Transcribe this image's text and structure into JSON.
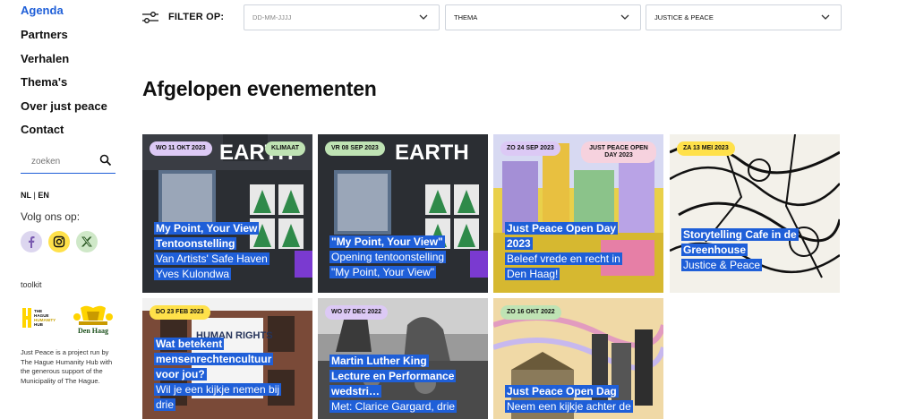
{
  "sidebar": {
    "nav": [
      "Agenda",
      "Partners",
      "Verhalen",
      "Thema's",
      "Over just peace",
      "Contact"
    ],
    "search_placeholder": "zoeken",
    "lang_nl": "NL",
    "lang_sep": " | ",
    "lang_en": "EN",
    "volg": "Volg ons op:",
    "toolkit": "toolkit",
    "logo_hub_lines": [
      "THE",
      "HAGUE",
      "HUMANITY",
      "HUB"
    ],
    "logo_city": "Den Haag",
    "footnote": "Just Peace is a project run by The Hague Humanity Hub with the generous support of the Municipality of The Hague."
  },
  "filter": {
    "label": "FILTER OP:",
    "date_placeholder": "DD-MM-JJJJ",
    "thema": "THEMA",
    "selected": "JUSTICE & PEACE"
  },
  "page_title": "Afgelopen evenementen",
  "colors": {
    "accent": "#1f5fd8",
    "badge_purple": "#dcc9f5",
    "badge_green": "#bfe3b4",
    "badge_yellow": "#ffe14a",
    "badge_pink": "#f6d2de"
  },
  "cards": [
    {
      "date": "WO 11 OKT 2023",
      "theme": "KLIMAAT",
      "title": [
        "My Point, Your View",
        "Tentoonstelling"
      ],
      "sub": [
        "Van Artists' Safe Haven",
        "Yves Kulondwa"
      ]
    },
    {
      "date": "VR 08 SEP 2023",
      "theme": "",
      "title": [
        "\"My Point, Your View\""
      ],
      "sub": [
        "Opening tentoonstelling",
        "\"My Point, Your View\""
      ]
    },
    {
      "date": "ZO 24 SEP 2023",
      "theme": "JUST PEACE OPEN DAY 2023",
      "title": [
        "Just Peace Open Day",
        "2023"
      ],
      "sub": [
        "Beleef vrede en recht in",
        "Den Haag!"
      ]
    },
    {
      "date": "ZA 13 MEI 2023",
      "theme": "",
      "title": [
        "Storytelling Cafe in de",
        "Greenhouse"
      ],
      "sub": [
        "Justice & Peace"
      ]
    },
    {
      "date": "DO 23 FEB 2023",
      "theme": "",
      "title": [
        "Wat betekent",
        "mensenrechtencultuur",
        "voor jou?"
      ],
      "sub": [
        "Wil je een kijkje nemen bij",
        "drie"
      ]
    },
    {
      "date": "WO 07 DEC 2022",
      "theme": "",
      "title": [
        "Martin Luther King",
        "Lecture en Performance",
        "wedstri…"
      ],
      "sub": [
        "Met: Clarice Gargard, drie"
      ]
    },
    {
      "date": "ZO 16 OKT 2022",
      "theme": "",
      "title": [
        "Just Peace Open Dag"
      ],
      "sub": [
        "Neem een kijkje achter de"
      ]
    }
  ],
  "card_art": [
    "EARTH",
    "EARTH",
    "",
    "",
    "HUMAN RIGHTS",
    "",
    ""
  ]
}
